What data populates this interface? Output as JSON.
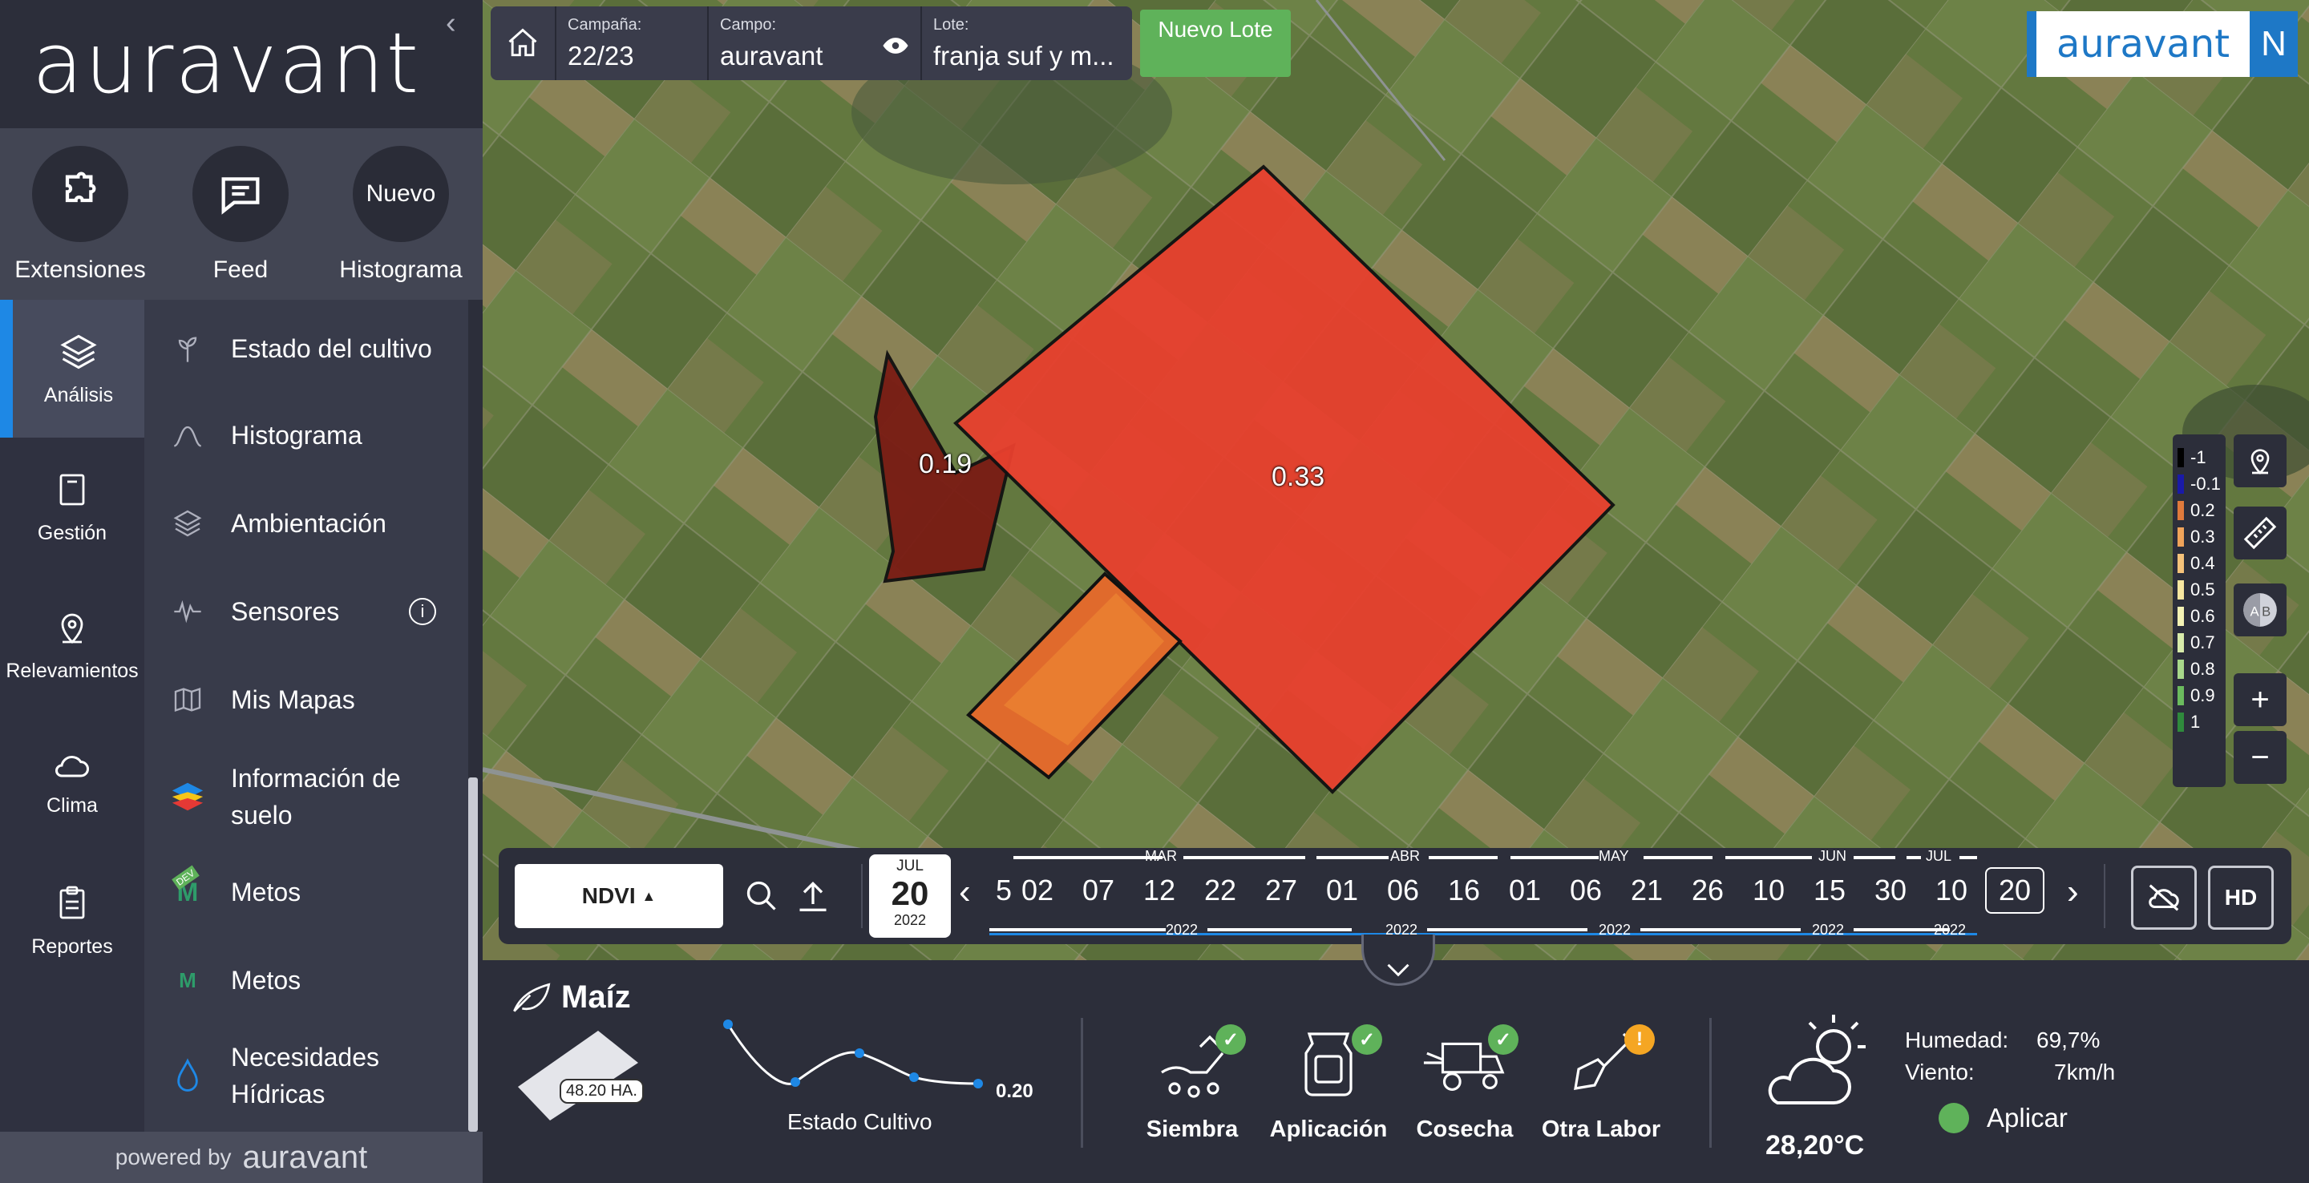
{
  "sidebar": {
    "logo": "auravant",
    "quick": [
      {
        "label": "Extensiones",
        "icon": "puzzle-icon"
      },
      {
        "label": "Feed",
        "icon": "chat-icon"
      },
      {
        "label": "Histograma",
        "circle_text": "Nuevo"
      }
    ],
    "nav": [
      {
        "label": "Análisis",
        "icon": "layers-icon",
        "active": true
      },
      {
        "label": "Gestión",
        "icon": "notebook-icon"
      },
      {
        "label": "Relevamientos",
        "icon": "map-pin-icon"
      },
      {
        "label": "Clima",
        "icon": "cloud-icon"
      },
      {
        "label": "Reportes",
        "icon": "clipboard-icon"
      }
    ],
    "sub": [
      {
        "label": "Estado del cultivo",
        "icon": "plant-icon"
      },
      {
        "label": "Histograma",
        "icon": "curve-icon"
      },
      {
        "label": "Ambientación",
        "icon": "layers-icon"
      },
      {
        "label": "Sensores",
        "icon": "wave-icon"
      },
      {
        "label": "Mis Mapas",
        "icon": "map-icon"
      },
      {
        "label": "Información de suelo",
        "icon": "soil-layers-icon"
      },
      {
        "label": "Metos",
        "icon": "metos-dev-icon",
        "tag": "DEV"
      },
      {
        "label": "Metos",
        "icon": "metos-icon"
      },
      {
        "label": "Necesidades Hídricas",
        "icon": "water-drop-icon"
      }
    ],
    "powered_prefix": "powered by",
    "powered_brand": "auravant"
  },
  "topbar": {
    "campaign_label": "Campaña:",
    "campaign_value": "22/23",
    "field_label": "Campo:",
    "field_value": "auravant",
    "lot_label": "Lote:",
    "lot_value": "franja suf y m...",
    "new_lot": "Nuevo Lote"
  },
  "brand": {
    "name": "auravant",
    "user_initial": "N"
  },
  "map": {
    "plots": [
      {
        "label": "0.19"
      },
      {
        "label": "0.33"
      }
    ]
  },
  "legend": [
    {
      "value": "-1",
      "color": "#000000"
    },
    {
      "value": "-0.1",
      "color": "#1a1aa8"
    },
    {
      "value": "0.2",
      "color": "#e07a3c"
    },
    {
      "value": "0.3",
      "color": "#f0a35a"
    },
    {
      "value": "0.4",
      "color": "#f5c27a"
    },
    {
      "value": "0.5",
      "color": "#f7e6a0"
    },
    {
      "value": "0.6",
      "color": "#f4f2b4"
    },
    {
      "value": "0.7",
      "color": "#d8ebaa"
    },
    {
      "value": "0.8",
      "color": "#a8d88a"
    },
    {
      "value": "0.9",
      "color": "#6bbb5e"
    },
    {
      "value": "1",
      "color": "#2f8a3c"
    }
  ],
  "timeline": {
    "index": "NDVI",
    "selected": {
      "month": "JUL",
      "day": "20",
      "year": "2022"
    },
    "days": [
      "5",
      "02",
      "07",
      "12",
      "22",
      "27",
      "01",
      "06",
      "16",
      "01",
      "06",
      "21",
      "26",
      "10",
      "15",
      "30",
      "10",
      "20"
    ],
    "months": [
      "MAR",
      "ABR",
      "MAY",
      "JUN",
      "JUL"
    ],
    "years": [
      "2022",
      "2022",
      "2022",
      "2022",
      "2022"
    ],
    "hd": "HD"
  },
  "bottom": {
    "crop": "Maíz",
    "area": "48.20 HA.",
    "state_label": "Estado Cultivo",
    "state_value": "0.20",
    "labores": [
      {
        "name": "Siembra",
        "status": "ok"
      },
      {
        "name": "Aplicación",
        "status": "ok"
      },
      {
        "name": "Cosecha",
        "status": "ok"
      },
      {
        "name": "Otra Labor",
        "status": "warning"
      }
    ],
    "temperature": "28,20°C",
    "humidity_label": "Humedad:",
    "humidity": "69,7%",
    "wind_label": "Viento:",
    "wind": "7km/h",
    "apply": "Aplicar"
  },
  "colors": {
    "accent": "#1e88e5",
    "green": "#5fb25a",
    "plot_red": "#e8402e",
    "plot_dark": "#7a1c14",
    "warning": "#f5a623"
  }
}
